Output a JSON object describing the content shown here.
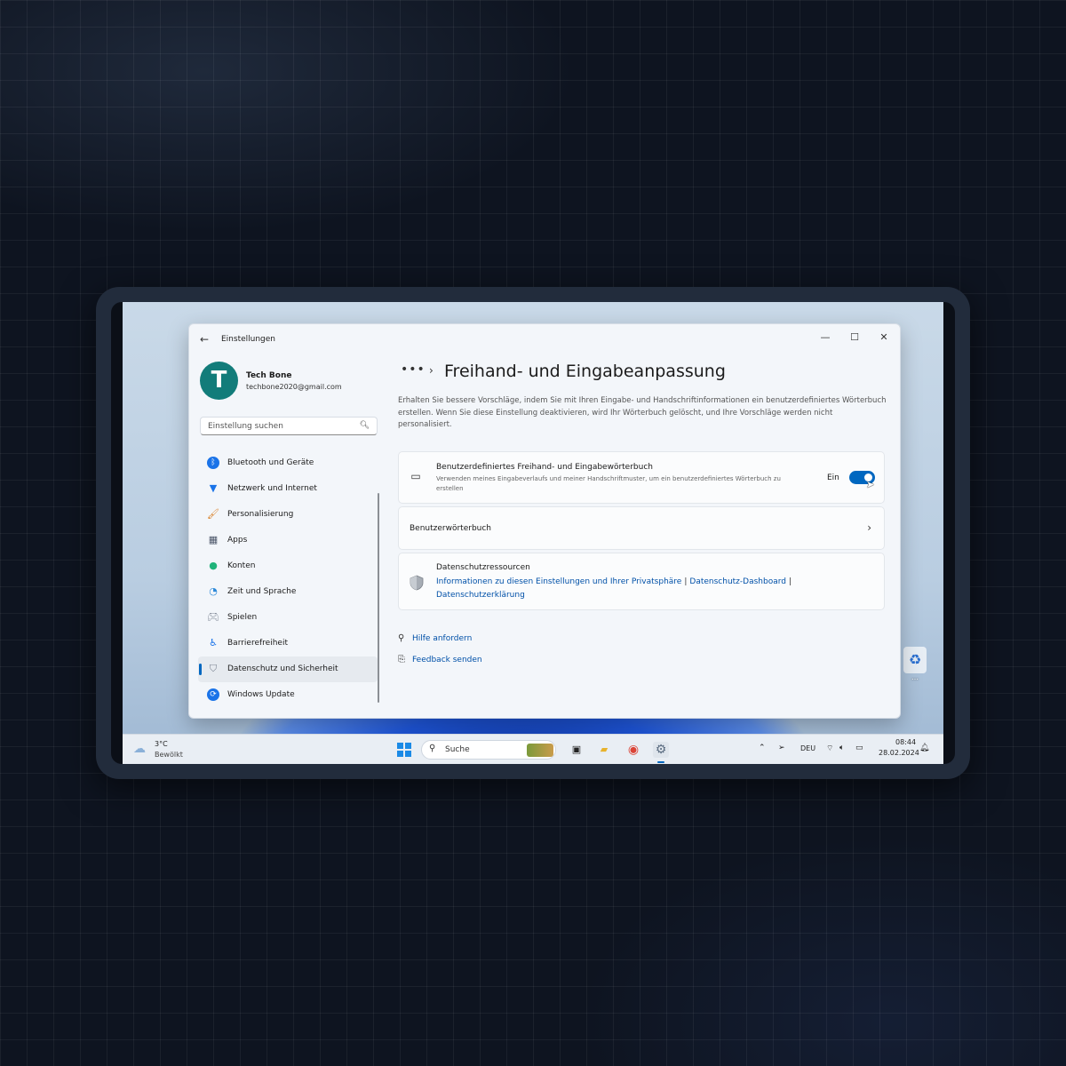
{
  "settings": {
    "app_title": "Einstellungen",
    "user": {
      "initial": "T",
      "name": "Tech Bone",
      "email": "techbone2020@gmail.com"
    },
    "search": {
      "placeholder": "Einstellung suchen"
    },
    "nav": [
      {
        "label": "Bluetooth und Geräte",
        "icon": "bluetooth-icon",
        "active": false
      },
      {
        "label": "Netzwerk und Internet",
        "icon": "wifi-icon",
        "active": false
      },
      {
        "label": "Personalisierung",
        "icon": "brush-icon",
        "active": false
      },
      {
        "label": "Apps",
        "icon": "apps-icon",
        "active": false
      },
      {
        "label": "Konten",
        "icon": "person-icon",
        "active": false
      },
      {
        "label": "Zeit und Sprache",
        "icon": "globe-clock-icon",
        "active": false
      },
      {
        "label": "Spielen",
        "icon": "gamepad-icon",
        "active": false
      },
      {
        "label": "Barrierefreiheit",
        "icon": "accessibility-icon",
        "active": false
      },
      {
        "label": "Datenschutz und Sicherheit",
        "icon": "shield-icon",
        "active": true
      },
      {
        "label": "Windows Update",
        "icon": "update-icon",
        "active": false
      }
    ],
    "main": {
      "breadcrumb_more": "•••",
      "title": "Freihand- und Eingabeanpassung",
      "description": "Erhalten Sie bessere Vorschläge, indem Sie mit Ihren Eingabe- und Handschriftinformationen ein benutzerdefiniertes Wörterbuch erstellen. Wenn Sie diese Einstellung deaktivieren, wird Ihr Wörterbuch gelöscht, und Ihre Vorschläge werden nicht personalisiert.",
      "dictionary_card": {
        "title": "Benutzerdefiniertes Freihand- und Eingabewörterbuch",
        "subtitle": "Verwenden meines Eingabeverlaufs und meiner Handschriftmuster, um ein benutzerdefiniertes Wörterbuch zu erstellen",
        "toggle_label": "Ein",
        "toggle_on": true
      },
      "user_dictionary_card": {
        "title": "Benutzerwörterbuch"
      },
      "privacy_card": {
        "title": "Datenschutzressourcen",
        "links": [
          "Informationen zu diesen Einstellungen und Ihrer Privatsphäre",
          "Datenschutz-Dashboard",
          "Datenschutzerklärung"
        ],
        "separator": "|"
      },
      "help_links": {
        "help": "Hilfe anfordern",
        "feedback": "Feedback senden"
      }
    }
  },
  "taskbar": {
    "weather": {
      "temp": "3°C",
      "condition": "Bewölkt"
    },
    "search_placeholder": "Suche",
    "language": "DEU",
    "time": "08:44",
    "date": "28.02.2024"
  },
  "colors": {
    "accent": "#0067c0",
    "link": "#0050a8",
    "avatar": "#127c7a"
  }
}
